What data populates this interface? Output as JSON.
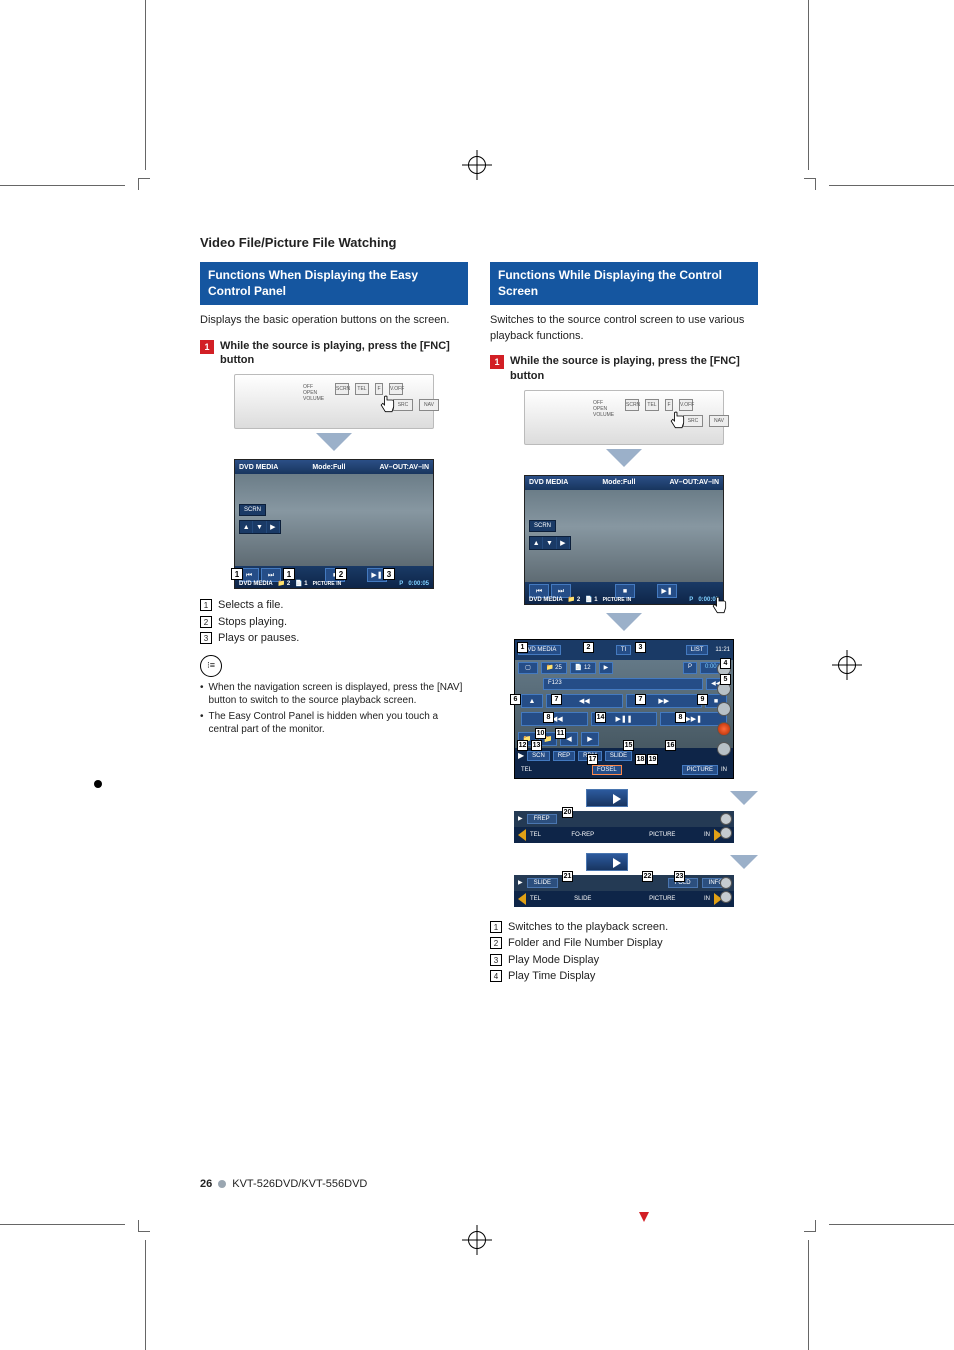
{
  "section_title": "Video File/Picture File Watching",
  "footer": {
    "page": "26",
    "model": "KVT-526DVD/KVT-556DVD"
  },
  "device_labels": {
    "off": "OFF",
    "open": "OPEN",
    "volume": "VOLUME",
    "scrn": "SCRN",
    "tel": "TEL",
    "vloff": "V.OFF",
    "src": "SRC",
    "nav": "NAV"
  },
  "left": {
    "header": "Functions When Displaying the Easy Control Panel",
    "intro": "Displays the basic operation buttons on the screen.",
    "step1": "While the source is playing, press the [FNC] button",
    "step_num": "1",
    "screen": {
      "top_left": "DVD MEDIA",
      "top_center": "Mode:Full",
      "top_right": "AV–OUT:AV–IN",
      "scrn": "SCRN",
      "btn_prev": "⏮",
      "btn_next": "⏭",
      "btn_stop": "■",
      "btn_play": "▶❚",
      "bottom_left": "DVD MEDIA",
      "bottom_chapter": "2",
      "bottom_track": "1",
      "picture": "PICTURE",
      "in": "IN",
      "p": "P",
      "time": "0:00:05"
    },
    "legend": {
      "1": "Selects a file.",
      "2": "Stops playing.",
      "3": "Plays or pauses."
    },
    "notes": [
      "When the navigation screen is displayed, press the [NAV] button to switch to the source playback screen.",
      "The Easy Control Panel is hidden when you touch a central part of the monitor."
    ]
  },
  "right": {
    "header": "Functions While Displaying the Control Screen",
    "intro": "Switches to the source control screen to use various playback functions.",
    "step1": "While the source is playing, press the [FNC] button",
    "step_num": "1",
    "screen1": {
      "top_left": "DVD MEDIA",
      "top_center": "Mode:Full",
      "top_right": "AV–OUT:AV–IN",
      "scrn": "SCRN",
      "bottom_left": "DVD MEDIA",
      "bottom_chapter": "2",
      "bottom_track": "1",
      "picture": "PICTURE",
      "in": "IN",
      "p": "P",
      "time": "0:00:05"
    },
    "ctrl": {
      "title": "DVD MEDIA",
      "tl": "TI",
      "list": "LIST",
      "folder": "25",
      "file": "12",
      "play": "▶",
      "p": "P",
      "time": "0:00:05",
      "track_label": "F123",
      "clock": "11:21",
      "eject": "▲",
      "rew": "◀◀",
      "ffwd": "▶▶",
      "prev": "❚◀◀",
      "playpause": "▶❚❚",
      "next": "▶▶❚",
      "folder_up": "▲",
      "folder_down": "▼",
      "scn": "SCN",
      "rep": "REP",
      "rdm": "RDM",
      "slide": "SLIDE",
      "fosel": "FOSEL",
      "picture": "PICTURE",
      "in": "IN",
      "tel": "TEL"
    },
    "bar1": {
      "frep": "FREP",
      "forep": "FO-REP",
      "picture": "PICTURE",
      "in": "IN",
      "tel": "TEL"
    },
    "bar2": {
      "slide": "SLIDE",
      "slide2": "SLIDE",
      "fold": "FOLD",
      "info": "INFO",
      "picture": "PICTURE",
      "in": "IN",
      "tel": "TEL"
    },
    "legend": {
      "1": "Switches to the playback screen.",
      "2": "Folder and File Number Display",
      "3": "Play Mode Display",
      "4": "Play Time Display"
    },
    "callouts": [
      "1",
      "2",
      "3",
      "4",
      "5",
      "6",
      "7",
      "8",
      "9",
      "10",
      "11",
      "12",
      "13",
      "14",
      "15",
      "16",
      "17",
      "18",
      "19",
      "20",
      "21",
      "22",
      "23"
    ]
  }
}
